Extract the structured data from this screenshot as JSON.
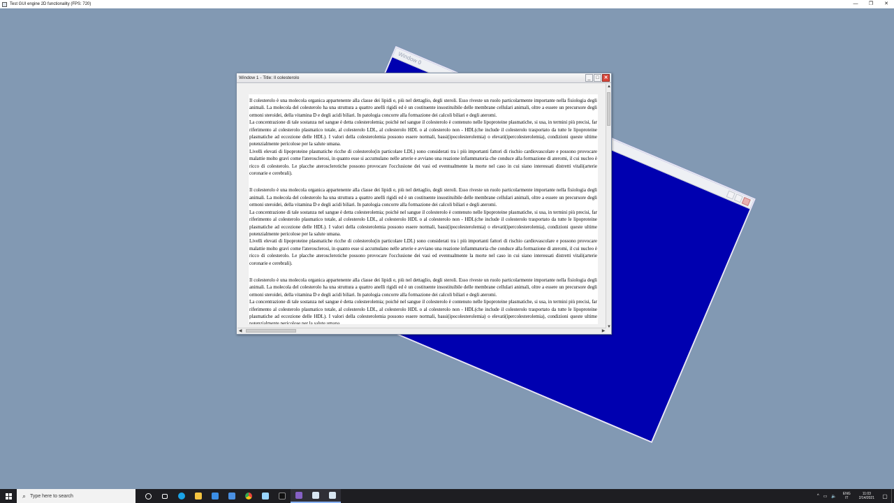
{
  "app": {
    "title": "Test GUI engine 2D functionality (FPS: 720)",
    "controls": {
      "minimize": "—",
      "maximize": "❐",
      "close": "✕"
    }
  },
  "back_window": {
    "title": "Window 0",
    "fill_color": "#0000b0"
  },
  "front_window": {
    "title": "Window 1 - Title: Il colesterolo",
    "controls": {
      "minimize": "_",
      "maximize": "□",
      "close": "✕"
    },
    "paragraph_block": [
      "Il colesterolo è una molecola organica appartenente alla classe dei lipidi e, più nel dettaglio, degli steroli. Esso riveste un ruolo particolarmente importante nella fisiologia degli animali. La molecola del colesterolo ha una struttura a quattro anelli rigidi ed è un costituente insostituibile delle membrane cellulari animali, oltre a essere un precursore degli ormoni steroidei, della vitamina D e degli acidi biliari. In patologia concorre alla formazione dei calcoli biliari e degli ateromi.",
      "La concentrazione di tale sostanza nel sangue è detta colesterolemia; poiché nel sangue il colesterolo è contenuto nelle lipoproteine plasmatiche, si usa, in termini più precisi, far riferimento al colesterolo plasmatico totale, al colesterolo LDL, al colesterolo HDL o al colesterolo non - HDL(che include il colesterolo trasportato da tutte le lipoproteine plasmatiche ad eccezione delle HDL). I valori della colesterolemia possono essere normali, bassi(ipocolesterolemia) o elevati(ipercolesterolemia), condizioni queste ultime potenzialmente pericolose per la salute umana.",
      "Livelli elevati di lipoproteine plasmatiche ricche di colesterolo(in particolare LDL) sono considerati tra i più importanti fattori di rischio cardiovascolare e possono provocare malattie molto gravi come l'aterosclerosi, in quanto esse si accumulano nelle arterie e avviano una reazione infiammatoria che conduce alla formazione di ateromi, il cui nucleo è ricco di colesterolo. Le placche aterosclerotiche possono provocare l'occlusione dei vasi ed eventualmente la morte nel caso in cui siano interessati distretti vitali(arterie coronarie e cerebrali)."
    ],
    "scroll": {
      "up": "▲",
      "down": "▼",
      "left": "◀",
      "right": "▶"
    }
  },
  "taskbar": {
    "search_placeholder": "Type here to search",
    "search_icon": "⌕",
    "icons": [
      {
        "name": "task-view-icon",
        "color": "#ffffff"
      },
      {
        "name": "multitask-icon",
        "color": "#ffffff"
      },
      {
        "name": "edge-icon",
        "color": "#1aa4e8"
      },
      {
        "name": "file-explorer-icon",
        "color": "#f3c340"
      },
      {
        "name": "store-icon",
        "color": "#3b8ee6"
      },
      {
        "name": "mail-icon",
        "color": "#4a90e2"
      },
      {
        "name": "chrome-icon",
        "color": "#e8453c"
      },
      {
        "name": "app-icon",
        "color": "#9ad6ff"
      },
      {
        "name": "terminal-icon",
        "color": "#111111"
      },
      {
        "name": "visual-studio-icon",
        "color": "#8661c5"
      },
      {
        "name": "window-app-icon",
        "color": "#d8e6f2"
      },
      {
        "name": "active-window-icon",
        "color": "#d8e6f2"
      }
    ],
    "tray": {
      "chevron": "^",
      "network": "▭",
      "speaker": "🔈",
      "lang_top": "ENG",
      "lang_bottom": "IT",
      "time": "11:03",
      "date": "2/14/2021",
      "notifications": "▢"
    }
  }
}
